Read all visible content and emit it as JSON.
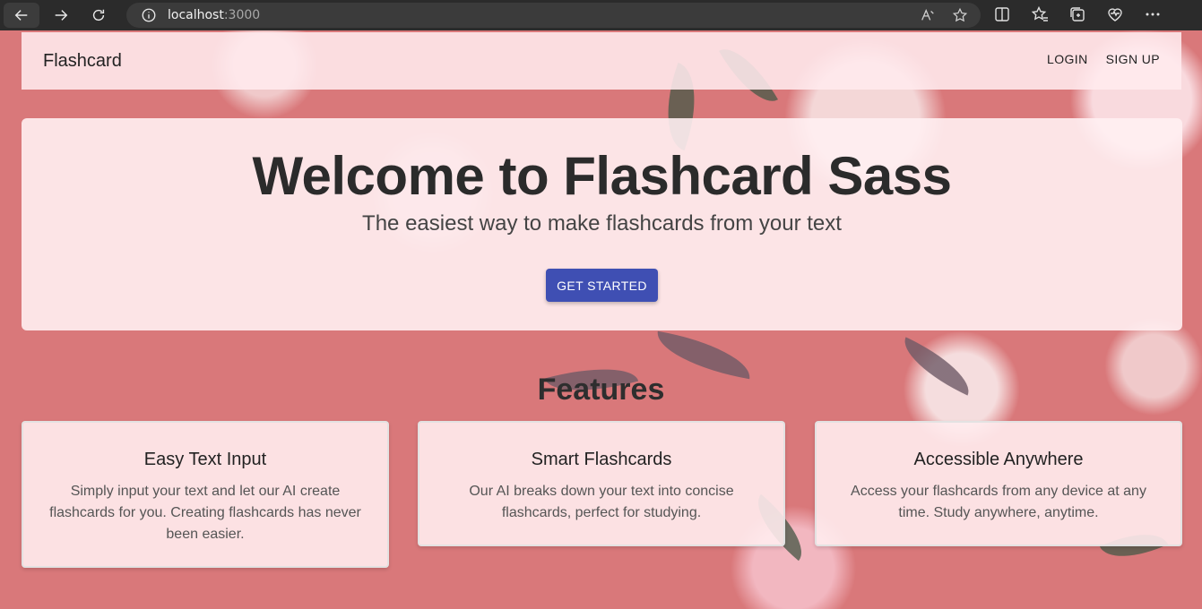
{
  "browser": {
    "url_host": "localhost",
    "url_port": ":3000"
  },
  "navbar": {
    "brand": "Flashcard",
    "links": [
      "LOGIN",
      "SIGN UP"
    ]
  },
  "hero": {
    "title": "Welcome to Flashcard Sass",
    "subtitle": "The easiest way to make flashcards from your text",
    "cta_label": "GET STARTED"
  },
  "features": {
    "heading": "Features",
    "items": [
      {
        "title": "Easy Text Input",
        "description": "Simply input your text and let our AI create flashcards for you. Creating flashcards has never been easier."
      },
      {
        "title": "Smart Flashcards",
        "description": "Our AI breaks down your text into concise flashcards, perfect for studying."
      },
      {
        "title": "Accessible Anywhere",
        "description": "Access your flashcards from any device at any time. Study anywhere, anytime."
      }
    ]
  },
  "colors": {
    "background": "#d9787a",
    "primary_button": "#3f4fb3",
    "card_background": "#ffeced"
  },
  "icons": [
    "back-icon",
    "forward-icon",
    "refresh-icon",
    "info-icon",
    "read-aloud-icon",
    "favorite-star-icon",
    "split-screen-icon",
    "favorites-icon",
    "collections-icon",
    "browser-essentials-icon",
    "more-icon"
  ]
}
